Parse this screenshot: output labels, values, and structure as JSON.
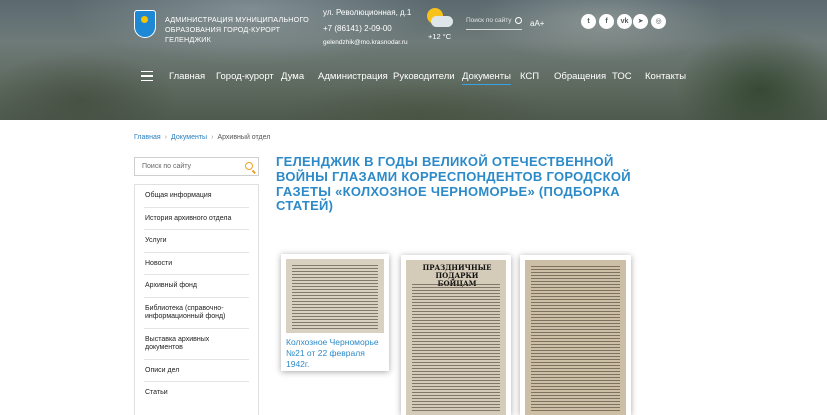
{
  "header": {
    "admin_name": "Администрация муниципального образования город-курорт Геленджик",
    "address": "ул. Революционная, д.1",
    "phone": "+7 (86141) 2-09-00",
    "email": "gelendzhik@mo.krasnodar.ru",
    "temperature": "+12 °C",
    "search_placeholder": "Поиск по сайту",
    "font_size_toggle": "аА+",
    "social": [
      {
        "icon": "twitter-icon",
        "glyph": "t"
      },
      {
        "icon": "facebook-icon",
        "glyph": "f"
      },
      {
        "icon": "vk-icon",
        "glyph": "vk"
      },
      {
        "icon": "telegram-icon",
        "glyph": "➤"
      },
      {
        "icon": "instagram-icon",
        "glyph": "◎"
      }
    ]
  },
  "nav": {
    "items": [
      "Главная",
      "Город-курорт",
      "Дума",
      "Администрация",
      "Руководители",
      "Документы",
      "КСП",
      "Обращения",
      "ТОС",
      "Контакты"
    ],
    "active": "Документы"
  },
  "breadcrumb": {
    "items": [
      "Главная",
      "Документы",
      "Архивный отдел"
    ]
  },
  "sidebar": {
    "search_placeholder": "Поиск по сайту",
    "items": [
      "Общая информация",
      "История архивного отдела",
      "Услуги",
      "Новости",
      "Архивный фонд",
      "Библиотека (справочно-информационный фонд)",
      "Выставка архивных документов",
      "Описи дел",
      "Статьи"
    ]
  },
  "main": {
    "title": "Геленджик в годы Великой Отечественной войны глазами корреспондентов городской газеты «Колхозное Черноморье» (подборка статей)",
    "cards": [
      {
        "caption": "Колхозное Черноморье №21 от 22 февраля 1942г."
      },
      {
        "clip_heading": "ПРАЗДНИЧНЫЕ ПОДАРКИ БОЙЦАМ"
      },
      {
        "clip_heading": ""
      }
    ]
  },
  "colors": {
    "accent": "#2c8ac8",
    "nav_active_underline": "#3aa2e0",
    "search_icon": "#f0a020"
  }
}
